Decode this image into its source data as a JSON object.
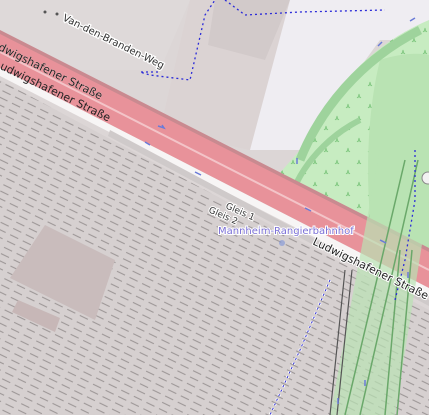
{
  "map": {
    "streets": {
      "van_den_branden_weg": "Van-den-Branden-Weg",
      "ludwigshafener_strasse_nw_1": "Ludwigshafener Straße",
      "ludwigshafener_strasse_nw_2": "Ludwigshafener Straße",
      "ludwigshafener_strasse_se": "Ludwigshafener Straße"
    },
    "rail": {
      "track_1": "Gleis 1",
      "track_2": "Gleis 2",
      "station": "Mannheim-Rangierbahnhof"
    },
    "colors": {
      "road": "#e8929a",
      "road_casing": "#c97c84",
      "park": "#bfe8b9",
      "park_dark": "#9fd89b",
      "industrial": "#d8d2d2",
      "building": "#c9bcbc",
      "station_text": "#7a6fd6",
      "boundary": "#2b2bd8",
      "tram": "#8fd28f"
    }
  }
}
